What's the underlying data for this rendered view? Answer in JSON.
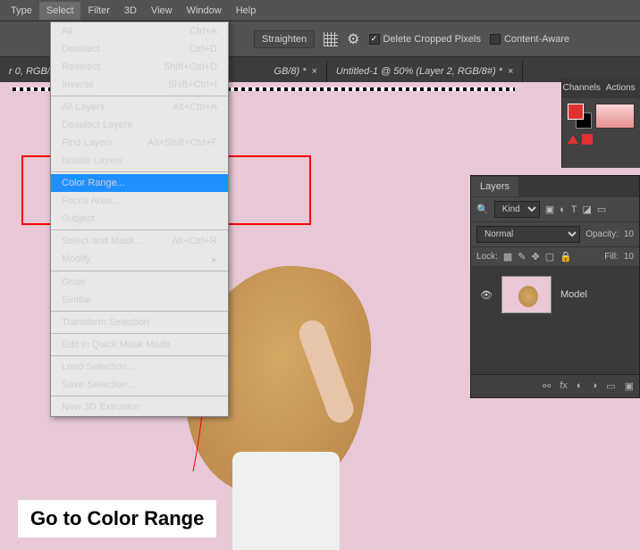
{
  "menubar": {
    "items": [
      "Type",
      "Select",
      "Filter",
      "3D",
      "View",
      "Window",
      "Help"
    ],
    "active": 1
  },
  "toolbar": {
    "straighten": "Straighten",
    "delete_cropped": "Delete Cropped Pixels",
    "content_aware": "Content-Aware"
  },
  "tabs": [
    {
      "label": "r 0, RGB/8) *"
    },
    {
      "label": "GB/8) *"
    },
    {
      "label": "Untitled-1 @ 50% (Layer 2, RGB/8#) *"
    }
  ],
  "dropdown": {
    "groups": [
      [
        {
          "label": "All",
          "shortcut": "Ctrl+A"
        },
        {
          "label": "Deselect",
          "shortcut": "Ctrl+D"
        },
        {
          "label": "Reselect",
          "shortcut": "Shift+Ctrl+D"
        },
        {
          "label": "Inverse",
          "shortcut": "Shift+Ctrl+I"
        }
      ],
      [
        {
          "label": "All Layers",
          "shortcut": "Alt+Ctrl+A"
        },
        {
          "label": "Deselect Layers",
          "shortcut": ""
        },
        {
          "label": "Find Layers",
          "shortcut": "Alt+Shift+Ctrl+F"
        },
        {
          "label": "Isolate Layers",
          "shortcut": ""
        }
      ],
      [
        {
          "label": "Color Range...",
          "shortcut": "",
          "selected": true
        },
        {
          "label": "Focus Area...",
          "shortcut": ""
        },
        {
          "label": "Subject",
          "shortcut": ""
        }
      ],
      [
        {
          "label": "Select and Mask...",
          "shortcut": "Alt+Ctrl+R"
        },
        {
          "label": "Modify",
          "shortcut": "▸"
        }
      ],
      [
        {
          "label": "Grow",
          "shortcut": "",
          "disabled": true
        },
        {
          "label": "Similar",
          "shortcut": "",
          "disabled": true
        }
      ],
      [
        {
          "label": "Transform Selection",
          "shortcut": "",
          "disabled": true
        }
      ],
      [
        {
          "label": "Edit in Quick Mask Mode",
          "shortcut": ""
        }
      ],
      [
        {
          "label": "Load Selection...",
          "shortcut": ""
        },
        {
          "label": "Save Selection...",
          "shortcut": "",
          "disabled": true
        }
      ],
      [
        {
          "label": "New 3D Extrusion",
          "shortcut": "",
          "disabled": true
        }
      ]
    ]
  },
  "right_tabs": {
    "channels": "Channels",
    "actions": "Actions"
  },
  "layers_panel": {
    "title": "Layers",
    "kind": "Kind",
    "blend": "Normal",
    "opacity_label": "Opacity:",
    "opacity_value": "10",
    "lock_label": "Lock:",
    "fill_label": "Fill:",
    "fill_value": "10",
    "layer_name": "Model",
    "search_icon": "🔍"
  },
  "annotation": "Go to Color Range"
}
